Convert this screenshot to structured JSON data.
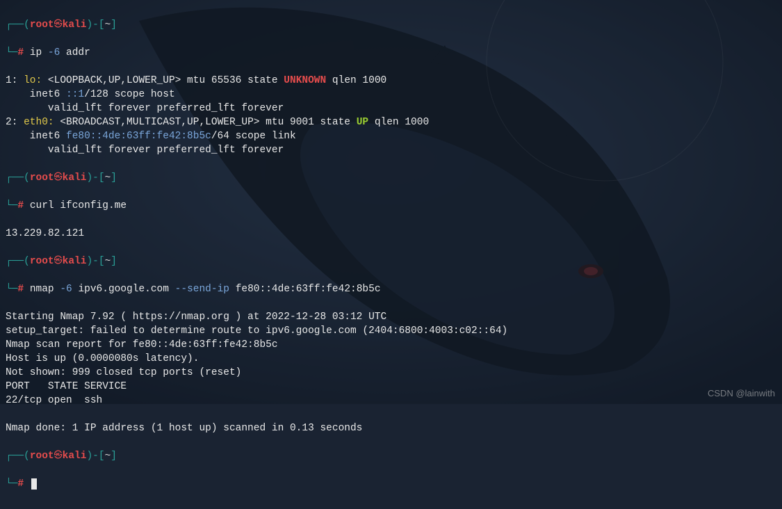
{
  "prompt": {
    "user": "root",
    "host": "kali",
    "path": "~",
    "symbol": "#"
  },
  "blocks": [
    {
      "command": {
        "bin": "ip",
        "flags": "-6",
        "args": "addr"
      },
      "output": {
        "iface1": {
          "idx": "1:",
          "name": "lo:",
          "flags": "<LOOPBACK,UP,LOWER_UP>",
          "rest": " mtu 65536 state ",
          "state": "UNKNOWN",
          "tail": " qlen 1000",
          "inet_pre": "    inet6 ",
          "addr": "::1",
          "inet_post": "/128 scope host",
          "valid": "       valid_lft forever preferred_lft forever"
        },
        "iface2": {
          "idx": "2:",
          "name": "eth0:",
          "flags": "<BROADCAST,MULTICAST,UP,LOWER_UP>",
          "rest": " mtu 9001 state ",
          "state": "UP",
          "tail": " qlen 1000",
          "inet_pre": "    inet6 ",
          "addr": "fe80::4de:63ff:fe42:8b5c",
          "inet_post": "/64 scope link",
          "valid": "       valid_lft forever preferred_lft forever"
        }
      }
    },
    {
      "command": {
        "bin": "curl",
        "flags": "",
        "args": "ifconfig.me"
      },
      "output_lines": [
        "13.229.82.121"
      ]
    },
    {
      "command": {
        "bin": "nmap",
        "flags": "-6",
        "mid": "ipv6.google.com",
        "flags2": "--send-ip",
        "args2": "fe80::4de:63ff:fe42:8b5c"
      },
      "output_lines": [
        "Starting Nmap 7.92 ( https://nmap.org ) at 2022-12-28 03:12 UTC",
        "setup_target: failed to determine route to ipv6.google.com (2404:6800:4003:c02::64)",
        "Nmap scan report for fe80::4de:63ff:fe42:8b5c",
        "Host is up (0.0000080s latency).",
        "Not shown: 999 closed tcp ports (reset)",
        "PORT   STATE SERVICE",
        "22/tcp open  ssh",
        "",
        "Nmap done: 1 IP address (1 host up) scanned in 0.13 seconds"
      ]
    }
  ],
  "watermark": "CSDN @lainwith"
}
